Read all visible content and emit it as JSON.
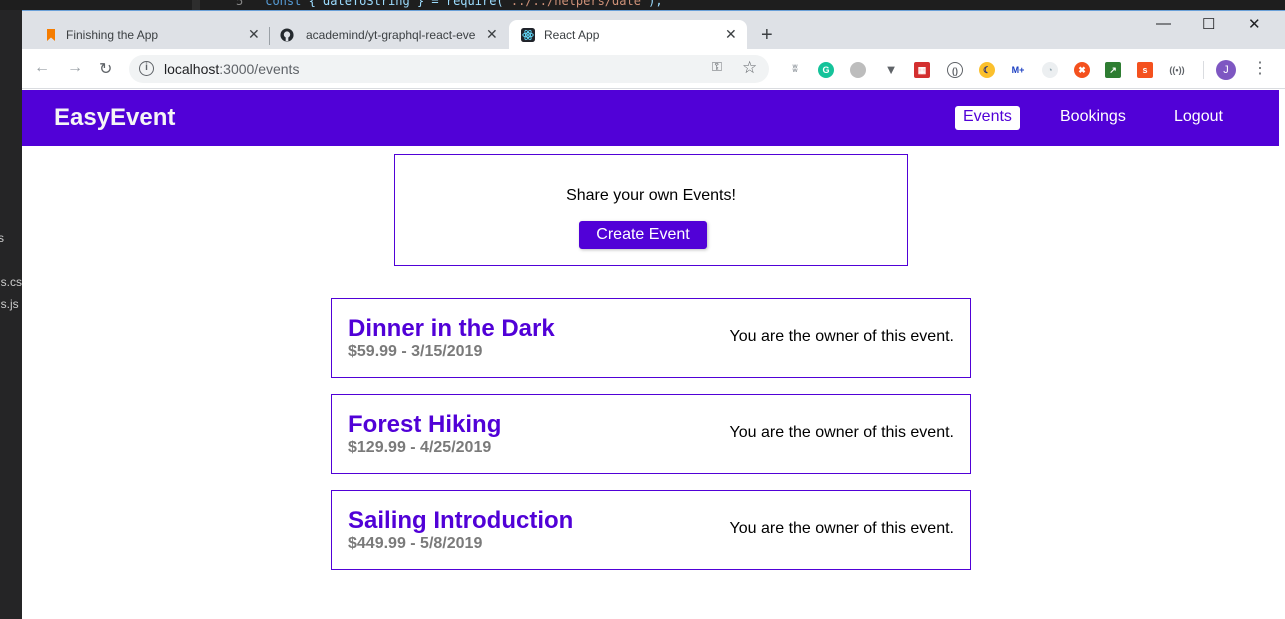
{
  "editor": {
    "line_number": "5",
    "code_keyword": "const",
    "code_ident": " { dateToString } = ",
    "code_call": "require(",
    "code_string": "\"../../helpers/date\"",
    "code_end": ");",
    "side_files": [
      "s",
      "ls.cs",
      "ls.js"
    ]
  },
  "browser": {
    "tabs": [
      {
        "title": "Finishing the App",
        "close": "✕"
      },
      {
        "title": "academind/yt-graphql-react-eve",
        "close": "✕"
      },
      {
        "title": "React App",
        "close": "✕"
      }
    ],
    "new_tab": "+",
    "window_controls": {
      "minimize": "—",
      "maximize": "☐",
      "close": "✕"
    },
    "url_host": "localhost",
    "url_path": ":3000/events",
    "profile_initial": "J"
  },
  "app": {
    "brand": "EasyEvent",
    "nav": [
      {
        "label": "Events",
        "active": true
      },
      {
        "label": "Bookings",
        "active": false
      },
      {
        "label": "Logout",
        "active": false
      }
    ],
    "control": {
      "text": "Share your own Events!",
      "button": "Create Event"
    },
    "events": [
      {
        "title": "Dinner in the Dark",
        "meta": "$59.99 - 3/15/2019",
        "owner_text": "You are the owner of this event."
      },
      {
        "title": "Forest Hiking",
        "meta": "$129.99 - 4/25/2019",
        "owner_text": "You are the owner of this event."
      },
      {
        "title": "Sailing Introduction",
        "meta": "$449.99 - 5/8/2019",
        "owner_text": "You are the owner of this event."
      }
    ]
  },
  "colors": {
    "accent": "#5101d7",
    "meta_gray": "#7a7a7a"
  }
}
